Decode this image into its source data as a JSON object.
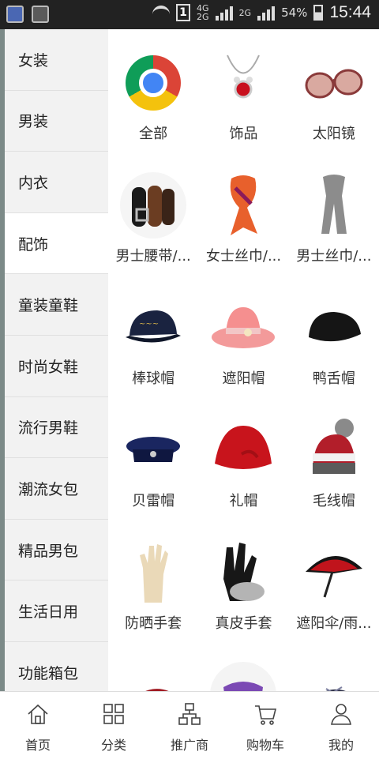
{
  "status_bar": {
    "sim": "1",
    "network_top": "4G",
    "network_bottom": "2G",
    "network2": "2G",
    "battery": "54%",
    "time": "15:44"
  },
  "sidebar": {
    "items": [
      {
        "label": "女装"
      },
      {
        "label": "男装"
      },
      {
        "label": "内衣"
      },
      {
        "label": "配饰",
        "active": true
      },
      {
        "label": "童装童鞋"
      },
      {
        "label": "时尚女鞋"
      },
      {
        "label": "流行男鞋"
      },
      {
        "label": "潮流女包"
      },
      {
        "label": "精品男包"
      },
      {
        "label": "生活日用"
      },
      {
        "label": "功能箱包"
      }
    ]
  },
  "grid": {
    "items": [
      {
        "label": "全部",
        "icon": "chrome-icon"
      },
      {
        "label": "饰品",
        "icon": "necklace-icon"
      },
      {
        "label": "太阳镜",
        "icon": "sunglasses-icon"
      },
      {
        "label": "男士腰带/...",
        "icon": "belt-icon"
      },
      {
        "label": "女士丝巾/...",
        "icon": "silk-scarf-icon"
      },
      {
        "label": "男士丝巾/...",
        "icon": "gray-scarf-icon"
      },
      {
        "label": "棒球帽",
        "icon": "baseball-cap-icon"
      },
      {
        "label": "遮阳帽",
        "icon": "sun-hat-icon"
      },
      {
        "label": "鸭舌帽",
        "icon": "flat-cap-icon"
      },
      {
        "label": "贝雷帽",
        "icon": "beret-icon"
      },
      {
        "label": "礼帽",
        "icon": "cloche-hat-icon"
      },
      {
        "label": "毛线帽",
        "icon": "knit-hat-icon"
      },
      {
        "label": "防晒手套",
        "icon": "sun-glove-icon"
      },
      {
        "label": "真皮手套",
        "icon": "leather-glove-icon"
      },
      {
        "label": "遮阳伞/雨...",
        "icon": "umbrella-icon"
      },
      {
        "label": "",
        "icon": "red-belt-icon"
      },
      {
        "label": "",
        "icon": "purple-mask-icon"
      },
      {
        "label": "",
        "icon": "plaid-scarf-icon"
      }
    ]
  },
  "bottom_nav": {
    "items": [
      {
        "label": "首页",
        "icon": "home-icon"
      },
      {
        "label": "分类",
        "icon": "category-grid-icon"
      },
      {
        "label": "推广商",
        "icon": "org-chart-icon"
      },
      {
        "label": "购物车",
        "icon": "cart-icon"
      },
      {
        "label": "我的",
        "icon": "profile-icon"
      }
    ]
  }
}
